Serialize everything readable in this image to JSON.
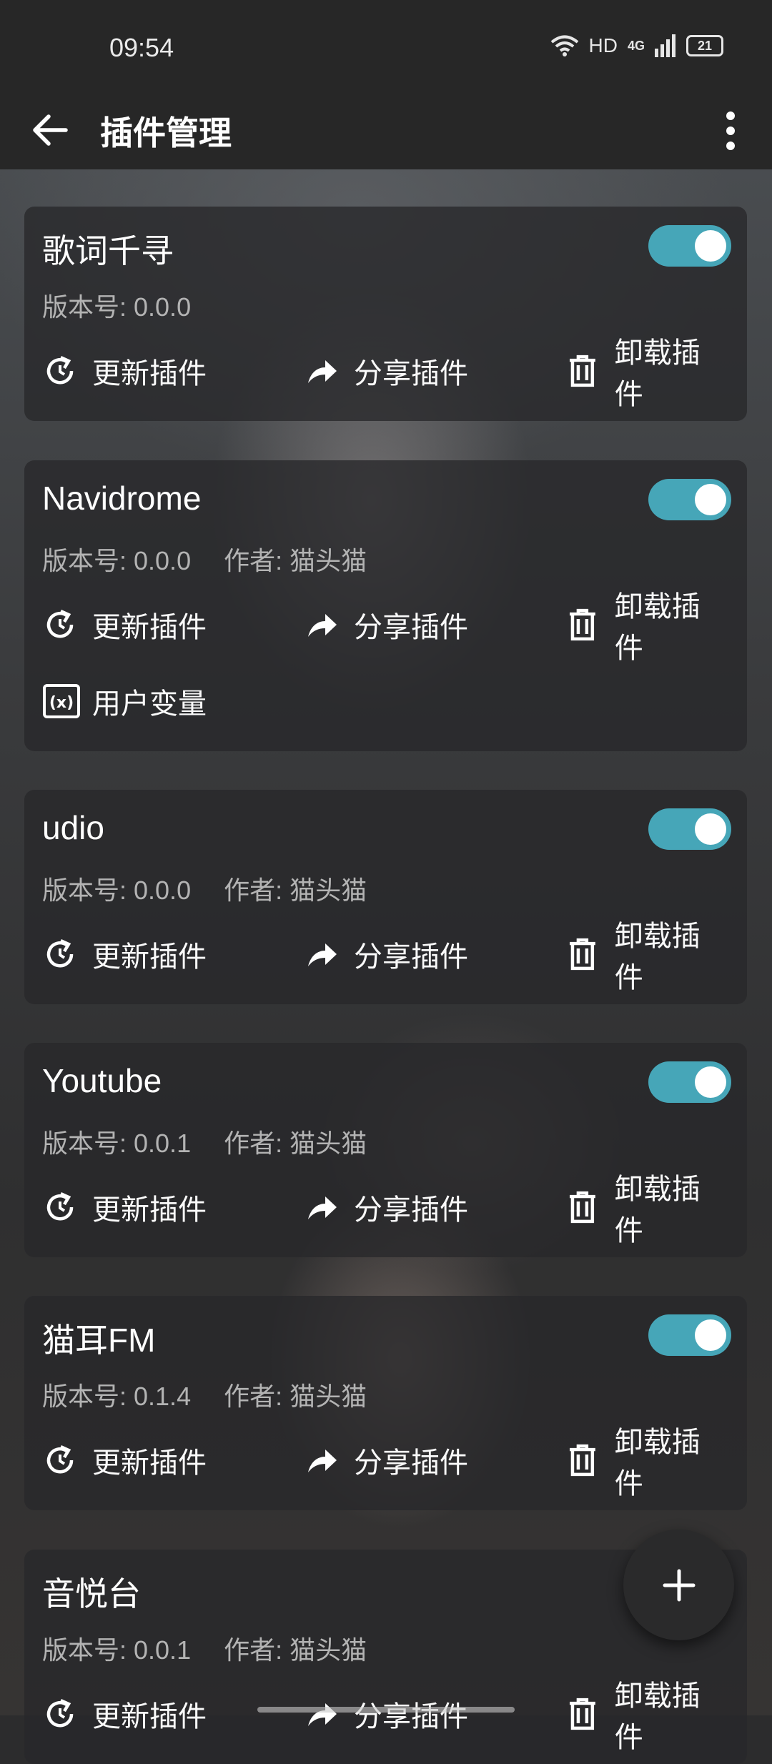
{
  "status": {
    "time": "09:54",
    "hd": "HD",
    "network": "4G",
    "battery": "21"
  },
  "appbar": {
    "title": "插件管理"
  },
  "labels": {
    "version_prefix": "版本号: ",
    "author_prefix": "作者: ",
    "update": "更新插件",
    "share": "分享插件",
    "uninstall": "卸载插件",
    "user_vars": "用户变量"
  },
  "plugins": [
    {
      "name": "歌词千寻",
      "version": "0.0.0",
      "author": "",
      "enabled": true,
      "user_vars": false
    },
    {
      "name": "Navidrome",
      "version": "0.0.0",
      "author": "猫头猫",
      "enabled": true,
      "user_vars": true
    },
    {
      "name": "udio",
      "version": "0.0.0",
      "author": "猫头猫",
      "enabled": true,
      "user_vars": false
    },
    {
      "name": "Youtube",
      "version": "0.0.1",
      "author": "猫头猫",
      "enabled": true,
      "user_vars": false
    },
    {
      "name": "猫耳FM",
      "version": "0.1.4",
      "author": "猫头猫",
      "enabled": true,
      "user_vars": false
    },
    {
      "name": "音悦台",
      "version": "0.0.1",
      "author": "猫头猫",
      "enabled": true,
      "user_vars": false
    }
  ],
  "colors": {
    "toggle_on": "#46a6b8",
    "appbar": "#272727"
  },
  "icons": {
    "back": "arrow-left-icon",
    "more": "more-vertical-icon",
    "add": "plus-icon"
  }
}
